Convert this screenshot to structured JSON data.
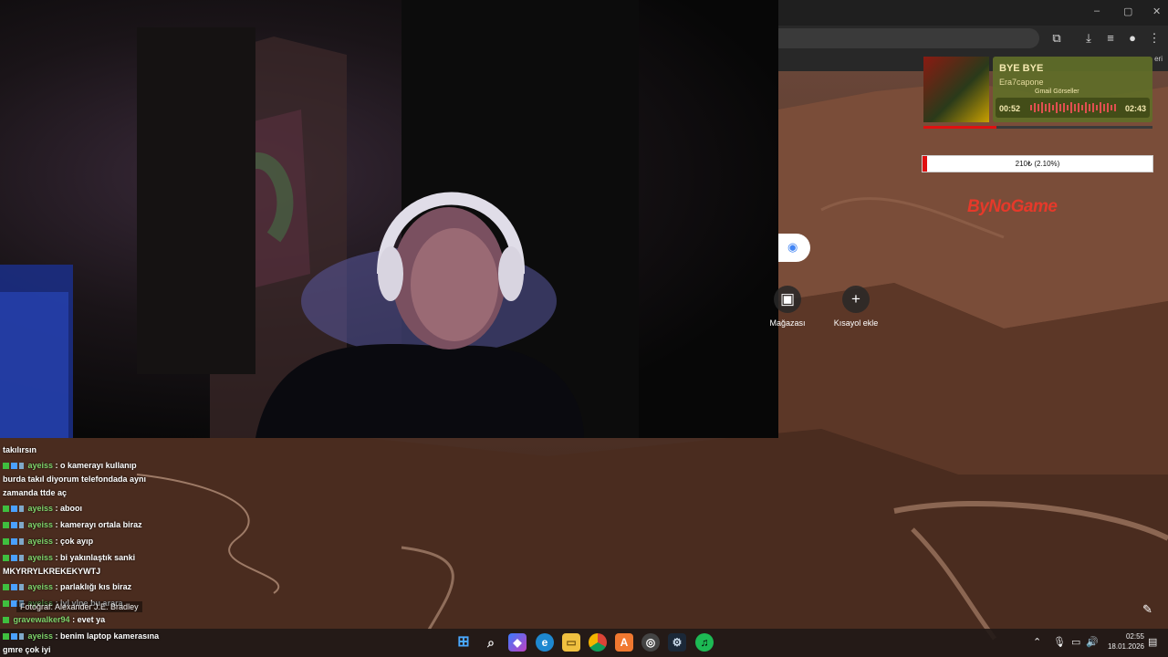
{
  "browser": {
    "bookmark_partial": "eri"
  },
  "spotify": {
    "track_title": "BYE BYE",
    "artist": "Era7capone",
    "elapsed": "00:52",
    "total": "02:43",
    "progress": 0.32,
    "overlap_text": "Gmail   Görseller"
  },
  "donation": {
    "text": "210₺ (2.10%)",
    "percent": 2.1
  },
  "sponsor": "ByNoGame",
  "newtab": {
    "shortcuts": [
      {
        "label": "Mağazası",
        "icon": "store-icon"
      },
      {
        "label": "Kısayol ekle",
        "icon": "plus-icon"
      }
    ]
  },
  "chat": {
    "messages": [
      {
        "user": "",
        "text": "takılırsın"
      },
      {
        "user": "ayeiss",
        "text": "o kamerayı kullanıp"
      },
      {
        "user": "",
        "text": "burda takıl diyorum telefondada aynı"
      },
      {
        "user": "",
        "text": "zamanda ttde aç"
      },
      {
        "user": "ayeiss",
        "text": "abooı"
      },
      {
        "user": "ayeiss",
        "text": "kamerayı ortala biraz"
      },
      {
        "user": "ayeiss",
        "text": "çok ayıp"
      },
      {
        "user": "ayeiss",
        "text": "bi yakınlaştık sanki"
      },
      {
        "user": "",
        "text": "MKYRRYLKREKEKYWTJ"
      },
      {
        "user": "ayeiss",
        "text": "parlaklığı kıs biraz"
      },
      {
        "user": "ayeiss",
        "text": "iyi vine bu arara"
      },
      {
        "user": "gravewalker94",
        "text": "evet ya"
      },
      {
        "user": "ayeiss",
        "text": "benim laptop kamerasına"
      },
      {
        "user": "",
        "text": "gmre çok iyi"
      }
    ]
  },
  "photo_credit": "Fotoğraf: Alexander J.E. Bradley",
  "taskbar": {
    "time": "02:55",
    "date": "18.01.2026"
  }
}
